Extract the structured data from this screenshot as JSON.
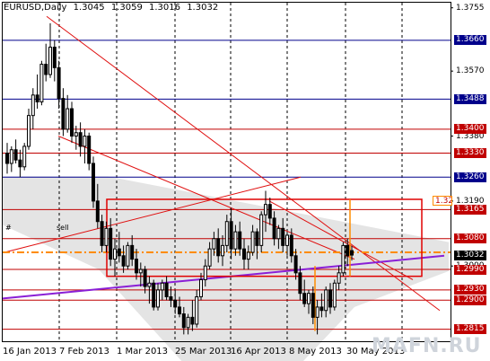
{
  "header": {
    "symbol": "EURUSD,Daily",
    "ohlc": [
      "1.3045",
      "1.3059",
      "1.3016",
      "1.3032"
    ]
  },
  "watermark": "MAFN.RU",
  "chart_data": {
    "type": "candlestick",
    "symbol": "EURUSD",
    "timeframe": "Daily",
    "last": {
      "open": 1.3045,
      "high": 1.3059,
      "low": 1.3016,
      "close": 1.3032
    },
    "x_tick_labels": [
      "16 Jan 2013",
      "7 Feb 2013",
      "1 Mar 2013",
      "25 Mar 2013",
      "16 Apr 2013",
      "8 May 2013",
      "30 May 2013"
    ],
    "y_tick_labels": [
      "1.3755",
      "1.3570",
      "1.3380",
      "1.3190",
      "1.3000"
    ],
    "ylim": [
      1.278,
      1.377
    ],
    "level_labels": [
      {
        "value": "1.3660",
        "style": "blue"
      },
      {
        "value": "1.3488",
        "style": "blue"
      },
      {
        "value": "1.3400",
        "style": "red"
      },
      {
        "value": "1.3330",
        "style": "red"
      },
      {
        "value": "1.3260",
        "style": "blue"
      },
      {
        "value": "1.3165",
        "style": "red"
      },
      {
        "value": "1.3080",
        "style": "red"
      },
      {
        "value": "1.3032",
        "style": "black"
      },
      {
        "value": "1.2990",
        "style": "red"
      },
      {
        "value": "1.2930",
        "style": "red"
      },
      {
        "value": "1.2900",
        "style": "red"
      },
      {
        "value": "1.2815",
        "style": "red"
      }
    ],
    "partial_label": "1.32",
    "annotations": [
      "#",
      "sell"
    ],
    "colors": {
      "level_red": "#c00000",
      "level_blue": "#00008b",
      "trend_red": "#e01010",
      "trend_purple": "#8a1fd6",
      "orange": "#ff8c00",
      "zone_gray": "#d9d9d9",
      "candle": "#000000"
    },
    "candles": [
      [
        1.333,
        1.336,
        1.327,
        1.33
      ],
      [
        1.33,
        1.335,
        1.3275,
        1.334
      ],
      [
        1.334,
        1.337,
        1.33,
        1.331
      ],
      [
        1.331,
        1.334,
        1.326,
        1.329
      ],
      [
        1.329,
        1.336,
        1.328,
        1.335
      ],
      [
        1.335,
        1.346,
        1.334,
        1.344
      ],
      [
        1.344,
        1.352,
        1.34,
        1.35
      ],
      [
        1.35,
        1.356,
        1.346,
        1.348
      ],
      [
        1.348,
        1.36,
        1.347,
        1.359
      ],
      [
        1.359,
        1.365,
        1.354,
        1.356
      ],
      [
        1.356,
        1.371,
        1.355,
        1.364
      ],
      [
        1.364,
        1.366,
        1.354,
        1.358
      ],
      [
        1.358,
        1.36,
        1.346,
        1.349
      ],
      [
        1.349,
        1.352,
        1.338,
        1.34
      ],
      [
        1.34,
        1.35,
        1.339,
        1.346
      ],
      [
        1.346,
        1.348,
        1.336,
        1.338
      ],
      [
        1.338,
        1.341,
        1.334,
        1.339
      ],
      [
        1.339,
        1.342,
        1.332,
        1.335
      ],
      [
        1.335,
        1.34,
        1.33,
        1.338
      ],
      [
        1.338,
        1.339,
        1.328,
        1.33
      ],
      [
        1.33,
        1.332,
        1.317,
        1.319
      ],
      [
        1.319,
        1.324,
        1.311,
        1.313
      ],
      [
        1.313,
        1.315,
        1.304,
        1.306
      ],
      [
        1.306,
        1.313,
        1.304,
        1.311
      ],
      [
        1.311,
        1.314,
        1.3,
        1.302
      ],
      [
        1.302,
        1.308,
        1.297,
        1.305
      ],
      [
        1.305,
        1.31,
        1.301,
        1.303
      ],
      [
        1.303,
        1.306,
        1.298,
        1.3
      ],
      [
        1.3,
        1.307,
        1.299,
        1.306
      ],
      [
        1.306,
        1.309,
        1.3,
        1.302
      ],
      [
        1.302,
        1.305,
        1.296,
        1.298
      ],
      [
        1.298,
        1.301,
        1.294,
        1.299
      ],
      [
        1.299,
        1.3,
        1.292,
        1.294
      ],
      [
        1.294,
        1.297,
        1.289,
        1.295
      ],
      [
        1.295,
        1.296,
        1.287,
        1.288
      ],
      [
        1.288,
        1.295,
        1.287,
        1.293
      ],
      [
        1.293,
        1.296,
        1.29,
        1.295
      ],
      [
        1.295,
        1.297,
        1.29,
        1.291
      ],
      [
        1.291,
        1.294,
        1.288,
        1.29
      ],
      [
        1.29,
        1.293,
        1.286,
        1.288
      ],
      [
        1.288,
        1.291,
        1.285,
        1.286
      ],
      [
        1.286,
        1.288,
        1.28,
        1.282
      ],
      [
        1.282,
        1.286,
        1.28,
        1.285
      ],
      [
        1.285,
        1.29,
        1.281,
        1.283
      ],
      [
        1.283,
        1.293,
        1.282,
        1.291
      ],
      [
        1.291,
        1.298,
        1.29,
        1.296
      ],
      [
        1.296,
        1.302,
        1.294,
        1.3
      ],
      [
        1.3,
        1.307,
        1.299,
        1.305
      ],
      [
        1.305,
        1.31,
        1.303,
        1.308
      ],
      [
        1.308,
        1.311,
        1.301,
        1.303
      ],
      [
        1.303,
        1.309,
        1.3,
        1.306
      ],
      [
        1.306,
        1.315,
        1.304,
        1.313
      ],
      [
        1.313,
        1.317,
        1.302,
        1.305
      ],
      [
        1.305,
        1.312,
        1.303,
        1.31
      ],
      [
        1.31,
        1.313,
        1.303,
        1.305
      ],
      [
        1.305,
        1.308,
        1.299,
        1.302
      ],
      [
        1.302,
        1.306,
        1.299,
        1.304
      ],
      [
        1.304,
        1.312,
        1.303,
        1.31
      ],
      [
        1.31,
        1.311,
        1.302,
        1.306
      ],
      [
        1.306,
        1.316,
        1.304,
        1.315
      ],
      [
        1.315,
        1.322,
        1.31,
        1.318
      ],
      [
        1.318,
        1.32,
        1.312,
        1.314
      ],
      [
        1.314,
        1.316,
        1.306,
        1.308
      ],
      [
        1.308,
        1.312,
        1.305,
        1.311
      ],
      [
        1.311,
        1.314,
        1.304,
        1.306
      ],
      [
        1.306,
        1.31,
        1.303,
        1.309
      ],
      [
        1.309,
        1.311,
        1.301,
        1.303
      ],
      [
        1.303,
        1.305,
        1.296,
        1.298
      ],
      [
        1.298,
        1.3,
        1.29,
        1.292
      ],
      [
        1.292,
        1.296,
        1.288,
        1.289
      ],
      [
        1.289,
        1.293,
        1.286,
        1.292
      ],
      [
        1.292,
        1.294,
        1.283,
        1.285
      ],
      [
        1.285,
        1.29,
        1.28,
        1.288
      ],
      [
        1.288,
        1.292,
        1.285,
        1.287
      ],
      [
        1.287,
        1.294,
        1.285,
        1.293
      ],
      [
        1.293,
        1.295,
        1.286,
        1.288
      ],
      [
        1.288,
        1.296,
        1.287,
        1.295
      ],
      [
        1.295,
        1.3,
        1.293,
        1.298
      ],
      [
        1.298,
        1.307,
        1.297,
        1.306
      ],
      [
        1.306,
        1.308,
        1.3,
        1.303
      ],
      [
        1.3045,
        1.3059,
        1.3016,
        1.3032
      ]
    ]
  }
}
